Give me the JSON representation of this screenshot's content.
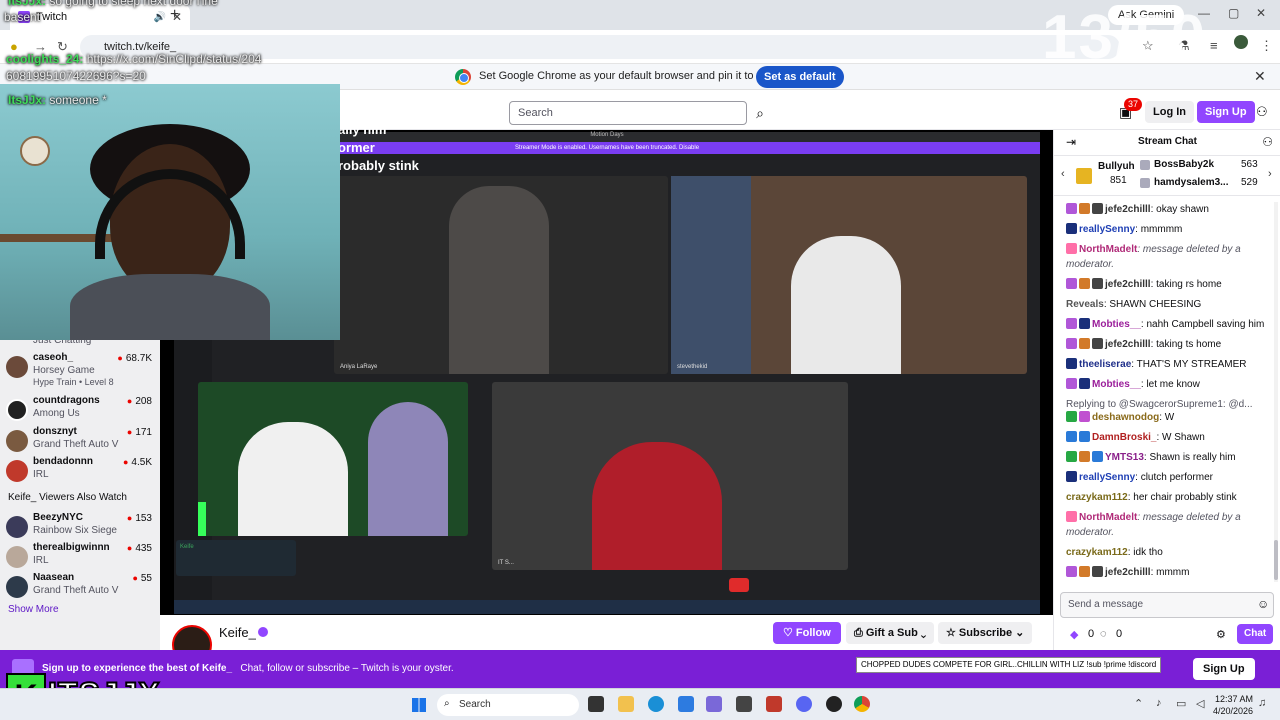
{
  "browser": {
    "tab_title": "Twitch",
    "tab_speaker": "🔊",
    "tab_close": "✕",
    "new_tab": "+",
    "url": "twitch.tv/keife_",
    "gemini_label": "Ask Gemini",
    "infobar_text": "Set Google Chrome as your default browser and pin it to your taskbar",
    "infobar_button": "Set as default",
    "infobar_close": "✕"
  },
  "overlay": {
    "lines": [
      {
        "user": "ItsJJx:",
        "text": "so going to sleep next door i'ine"
      },
      {
        "user": "",
        "text": "basent"
      },
      {
        "user": "coolights_24:",
        "text": "https://x.com/SinClipd/status/204"
      },
      {
        "user": "",
        "text": "6081995107422696?s=20"
      },
      {
        "user": "ItsJJx:",
        "text": "someone *"
      }
    ],
    "counter": "13/50",
    "stream_text": [
      "ally him",
      "ormer",
      "robably stink"
    ]
  },
  "twitch_nav": {
    "search_placeholder": "Search",
    "inbox_count": "37",
    "login": "Log In",
    "signup": "Sign Up"
  },
  "sidebar": {
    "top_partial": "Just Chatting",
    "channels": [
      {
        "name": "caseoh_",
        "game": "Horsey Game",
        "extra": "Hype Train • Level 8",
        "viewers": "68.7K",
        "color": "#6b4a3a"
      },
      {
        "name": "countdragons",
        "game": "Among Us",
        "extra": "",
        "viewers": "208",
        "color": "#222222"
      },
      {
        "name": "donsznyt",
        "game": "Grand Theft Auto V",
        "extra": "",
        "viewers": "171",
        "color": "#7a5a40"
      },
      {
        "name": "bendadonnn",
        "game": "IRL",
        "extra": "",
        "viewers": "4.5K",
        "color": "#c0392b"
      }
    ],
    "also_watch_header": "Keife_ Viewers Also Watch",
    "also_watch": [
      {
        "name": "BeezyNYC",
        "game": "Rainbow Six Siege",
        "viewers": "153",
        "color": "#3b3b5a"
      },
      {
        "name": "therealbigwinnn",
        "game": "IRL",
        "viewers": "435",
        "color": "#b9a89a"
      },
      {
        "name": "Naasean",
        "game": "Grand Theft Auto V",
        "viewers": "55",
        "color": "#2d3a4a"
      }
    ],
    "show_more": "Show More"
  },
  "player": {
    "top_label": "Motion Days",
    "banner": "Streamer Mode is enabled. Usernames have been truncated.  Disable",
    "tiles": [
      "Aniya LaRaye",
      "stevethekid",
      "Keife",
      "IT S..."
    ]
  },
  "chat": {
    "title": "Stream Chat",
    "leaderboard": [
      {
        "name": "Bullyuh",
        "value": "851"
      },
      {
        "name": "BossBaby2k",
        "value": "563"
      },
      {
        "name": "hamdysalem3...",
        "value": "529"
      }
    ],
    "messages": [
      {
        "user": "jefe2chilll",
        "color": "#333333",
        "text": ": okay shawn",
        "deleted": false,
        "badges": [
          "#b057d8",
          "#d27a2a",
          "#444"
        ]
      },
      {
        "user": "reallySenny",
        "color": "#1e3fb4",
        "text": ": mmmmm",
        "deleted": false,
        "badges": [
          "#1a2f7a"
        ]
      },
      {
        "user": "NorthMadelt",
        "color": "#b02a78",
        "text": ": message deleted by a moderator.",
        "deleted": true,
        "badges": [
          "#ff6fa8"
        ]
      },
      {
        "user": "jefe2chilll",
        "color": "#333333",
        "text": ": taking rs home",
        "deleted": false,
        "badges": [
          "#b057d8",
          "#d27a2a",
          "#444"
        ]
      },
      {
        "user": "Reveals",
        "color": "#555555",
        "text": ": SHAWN CHEESING",
        "deleted": false,
        "badges": []
      },
      {
        "user": "Mobties__",
        "color": "#9b1f9b",
        "text": ": nahh Campbell saving him",
        "deleted": false,
        "badges": [
          "#b057d8",
          "#1a2f7a"
        ]
      },
      {
        "user": "jefe2chilll",
        "color": "#333333",
        "text": ": taking ts home",
        "deleted": false,
        "badges": [
          "#b057d8",
          "#d27a2a",
          "#444"
        ]
      },
      {
        "user": "theeliserae",
        "color": "#1f2f8a",
        "text": ": THAT'S MY STREAMER",
        "deleted": false,
        "badges": [
          "#1a2f7a"
        ]
      },
      {
        "user": "Mobties__",
        "color": "#9b1f9b",
        "text": ": let me know",
        "deleted": false,
        "badges": [
          "#b057d8",
          "#1a2f7a"
        ]
      },
      {
        "user": "Replying to @SwagcerorSupreme1: @d...",
        "color": "#53535f",
        "text": "",
        "deleted": false,
        "badges": []
      },
      {
        "user": "deshawnodog",
        "color": "#8a6a1a",
        "text": ": W",
        "deleted": false,
        "badges": [
          "#27a844",
          "#c050d0"
        ]
      },
      {
        "user": "DamnBroski_",
        "color": "#b02020",
        "text": ": W Shawn",
        "deleted": false,
        "badges": [
          "#2a7ad8",
          "#2a7ad8"
        ]
      },
      {
        "user": "YMTS13",
        "color": "#8a1f8a",
        "text": ": Shawn is really him",
        "deleted": false,
        "badges": [
          "#27a844",
          "#d27a2a",
          "#2a7ad8"
        ]
      },
      {
        "user": "reallySenny",
        "color": "#1e3fb4",
        "text": ": clutch performer",
        "deleted": false,
        "badges": [
          "#1a2f7a"
        ]
      },
      {
        "user": "crazykam112",
        "color": "#7a6a1a",
        "text": ": her chair probably stink",
        "deleted": false,
        "badges": []
      },
      {
        "user": "NorthMadelt",
        "color": "#b02a78",
        "text": ": message deleted by a moderator.",
        "deleted": true,
        "badges": [
          "#ff6fa8"
        ]
      },
      {
        "user": "crazykam112",
        "color": "#7a6a1a",
        "text": ": idk tho",
        "deleted": false,
        "badges": []
      },
      {
        "user": "jefe2chilll",
        "color": "#333333",
        "text": ": mmmm",
        "deleted": false,
        "badges": [
          "#b057d8",
          "#d27a2a",
          "#444"
        ]
      }
    ],
    "input_placeholder": "Send a message",
    "points_a": "0",
    "points_b": "0",
    "chat_button": "Chat"
  },
  "channel": {
    "name": "Keife_",
    "follow": "Follow",
    "gift": "Gift a Sub",
    "subscribe": "Subscribe"
  },
  "signup_banner": {
    "bold": "Sign up to experience the best of Keife_",
    "rest": "Chat, follow or subscribe – Twitch is your oyster.",
    "button": "Sign Up",
    "tooltip": "CHOPPED DUDES COMPETE FOR GIRL..CHILLIN WITH LIZ !sub !prime !discord"
  },
  "watermark": {
    "k": "K",
    "text": "ITSJJX"
  },
  "taskbar": {
    "search": "Search",
    "time": "12:37 AM",
    "date": "4/20/2026"
  }
}
